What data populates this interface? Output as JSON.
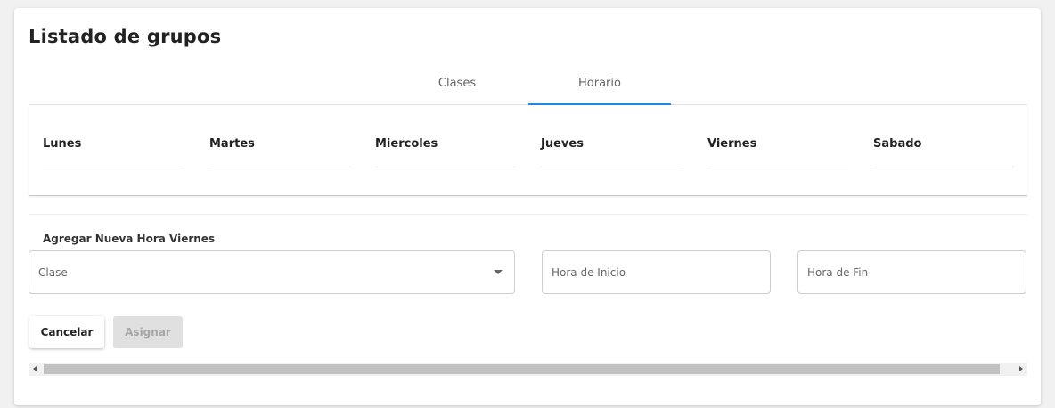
{
  "page": {
    "title": "Listado de grupos"
  },
  "tabs": [
    {
      "label": "Clases",
      "active": false
    },
    {
      "label": "Horario",
      "active": true
    }
  ],
  "accent_color": "#1e88e5",
  "days": [
    "Lunes",
    "Martes",
    "Miercoles",
    "Jueves",
    "Viernes",
    "Sabado"
  ],
  "form": {
    "title": "Agregar Nueva Hora Viernes",
    "clase_placeholder": "Clase",
    "hora_inicio_placeholder": "Hora de Inicio",
    "hora_fin_placeholder": "Hora de Fin",
    "cancel_label": "Cancelar",
    "assign_label": "Asignar"
  }
}
